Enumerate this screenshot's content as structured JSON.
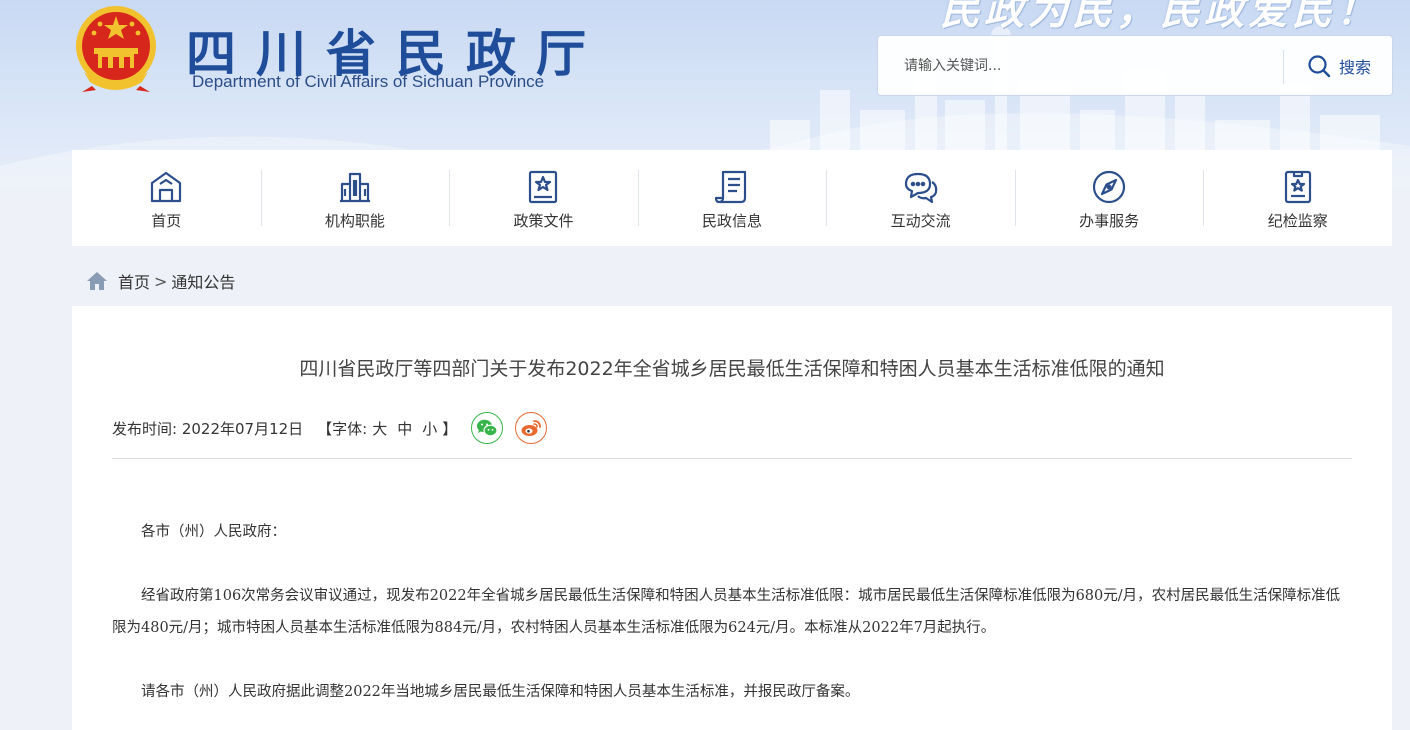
{
  "header": {
    "slogan": "民政为民，民政爱民！",
    "title": "四川省民政厅",
    "subtitle": "Department of Civil Affairs of Sichuan Province",
    "search_placeholder": "请输入关键词...",
    "search_label": "搜索"
  },
  "nav": {
    "items": [
      {
        "label": "首页",
        "icon": "home-icon"
      },
      {
        "label": "机构职能",
        "icon": "building-icon"
      },
      {
        "label": "政策文件",
        "icon": "policy-book-icon"
      },
      {
        "label": "民政信息",
        "icon": "document-icon"
      },
      {
        "label": "互动交流",
        "icon": "chat-icon"
      },
      {
        "label": "办事服务",
        "icon": "compass-icon"
      },
      {
        "label": "纪检监察",
        "icon": "badge-icon"
      }
    ]
  },
  "breadcrumb": {
    "home": "首页",
    "separator": ">",
    "current": "通知公告"
  },
  "article": {
    "title": "四川省民政厅等四部门关于发布2022年全省城乡居民最低生活保障和特困人员基本生活标准低限的通知",
    "meta_publish": "发布时间: 2022年07月12日",
    "meta_font_open": "【字体:",
    "font_large": "大",
    "font_medium": "中",
    "font_small": "小",
    "meta_font_close": "】",
    "paragraphs": [
      "各市（州）人民政府：",
      "经省政府第106次常务会议审议通过，现发布2022年全省城乡居民最低生活保障和特困人员基本生活标准低限：城市居民最低生活保障标准低限为680元/月，农村居民最低生活保障标准低限为480元/月；城市特困人员基本生活标准低限为884元/月，农村特困人员基本生活标准低限为624元/月。本标准从2022年7月起执行。",
      "请各市（州）人民政府据此调整2022年当地城乡居民最低生活保障和特困人员基本生活标准，并报民政厅备案。"
    ]
  },
  "colors": {
    "brand_blue": "#1f4d9a",
    "nav_icon": "#2c4f8c",
    "wechat_green": "#38b54a",
    "weibo_orange": "#e8692f",
    "emblem_red": "#d7261c",
    "emblem_gold": "#f2c12e"
  }
}
